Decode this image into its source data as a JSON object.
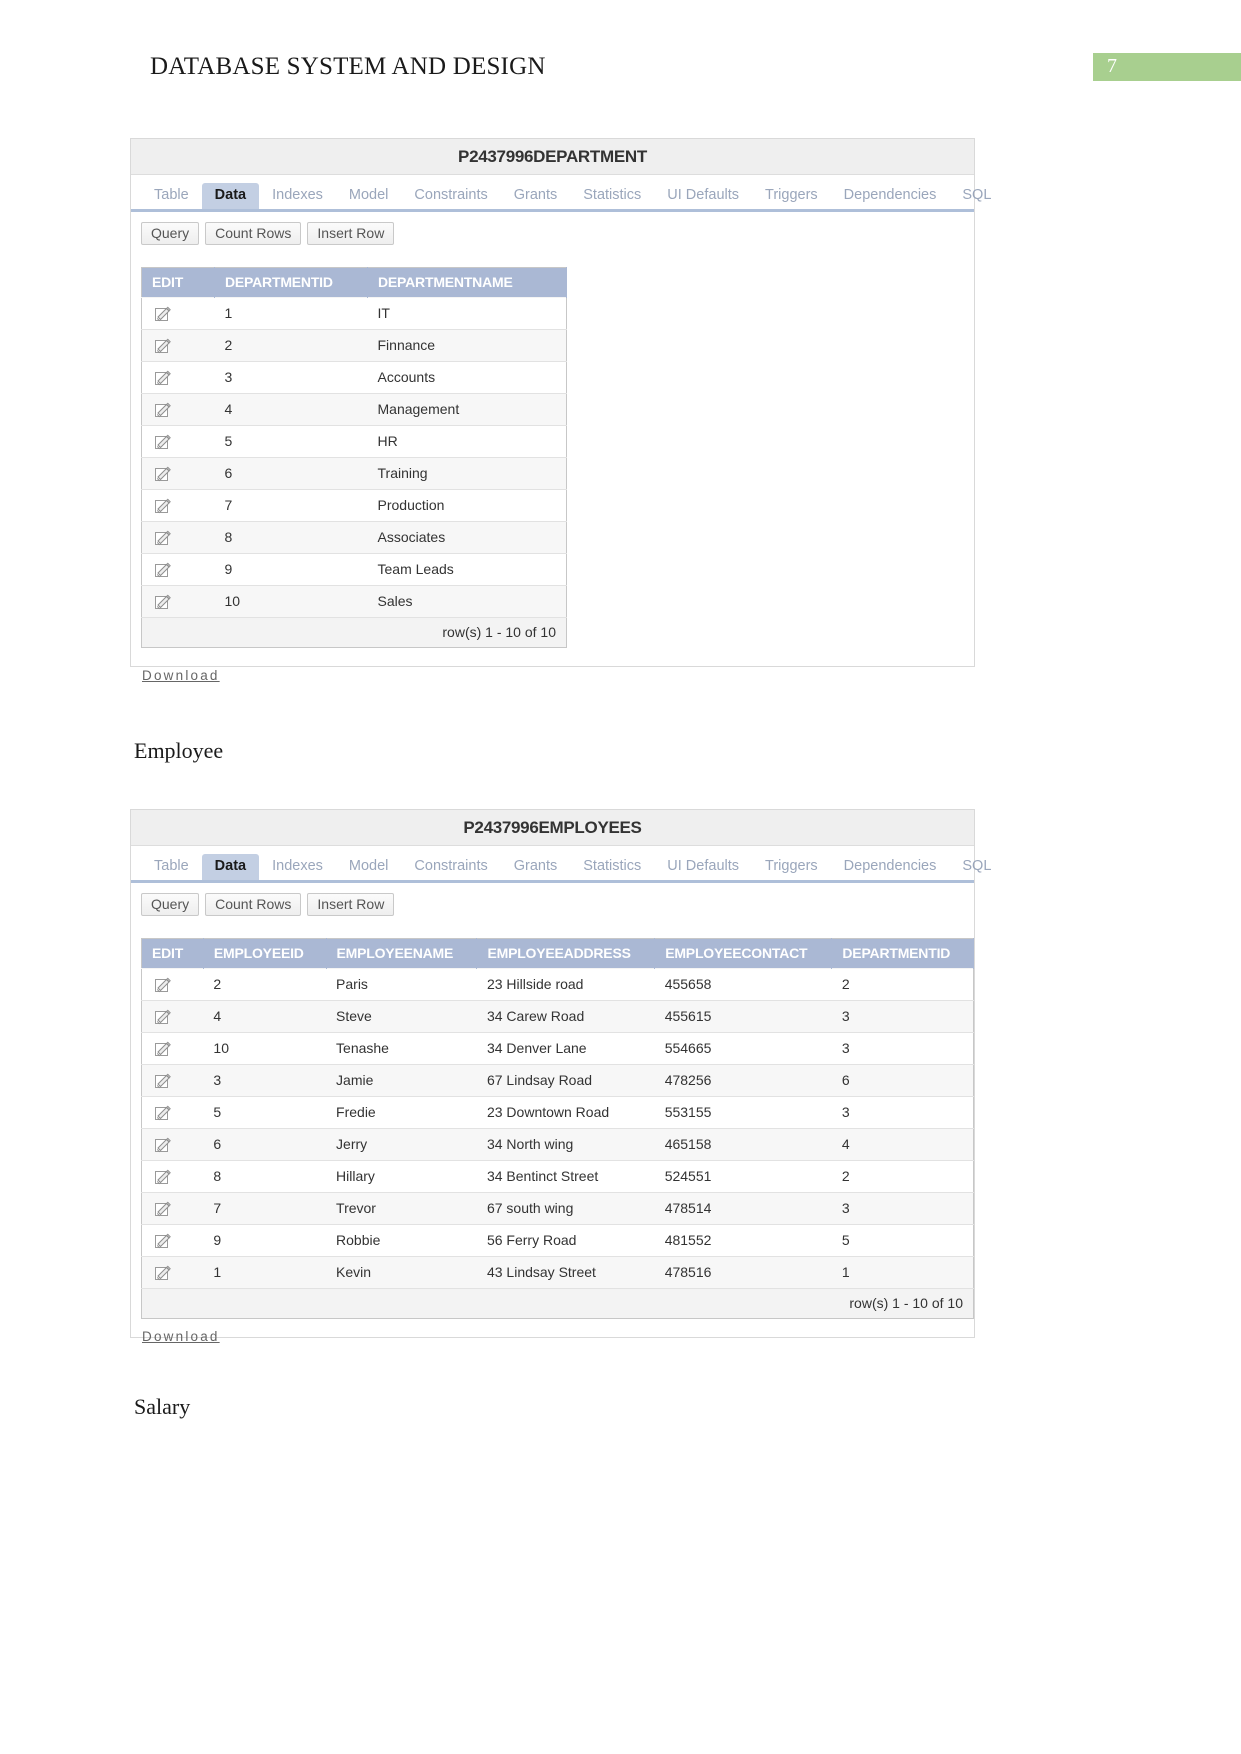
{
  "document": {
    "header_title": "DATABASE SYSTEM AND DESIGN",
    "page_number": "7"
  },
  "colors": {
    "page_badge_green": "#a8cf8f",
    "table_header_blue": "#aab8d4",
    "tab_underline": "#aebfd9",
    "active_tab_bg": "#c3cfe3"
  },
  "sections": {
    "employee_label": "Employee",
    "salary_label": "Salary"
  },
  "department_panel": {
    "title": "P2437996DEPARTMENT",
    "tabs": [
      {
        "label": "Table",
        "active": false
      },
      {
        "label": "Data",
        "active": true
      },
      {
        "label": "Indexes",
        "active": false
      },
      {
        "label": "Model",
        "active": false
      },
      {
        "label": "Constraints",
        "active": false
      },
      {
        "label": "Grants",
        "active": false
      },
      {
        "label": "Statistics",
        "active": false
      },
      {
        "label": "UI Defaults",
        "active": false
      },
      {
        "label": "Triggers",
        "active": false
      },
      {
        "label": "Dependencies",
        "active": false
      },
      {
        "label": "SQL",
        "active": false
      }
    ],
    "buttons": [
      {
        "label": "Query"
      },
      {
        "label": "Count Rows"
      },
      {
        "label": "Insert Row"
      }
    ],
    "columns": [
      "EDIT",
      "DEPARTMENTID",
      "DEPARTMENTNAME"
    ],
    "rows": [
      {
        "edit": "edit-pencil-icon",
        "departmentid": "1",
        "departmentname": "IT"
      },
      {
        "edit": "edit-pencil-icon",
        "departmentid": "2",
        "departmentname": "Finnance"
      },
      {
        "edit": "edit-pencil-icon",
        "departmentid": "3",
        "departmentname": "Accounts"
      },
      {
        "edit": "edit-pencil-icon",
        "departmentid": "4",
        "departmentname": "Management"
      },
      {
        "edit": "edit-pencil-icon",
        "departmentid": "5",
        "departmentname": "HR"
      },
      {
        "edit": "edit-pencil-icon",
        "departmentid": "6",
        "departmentname": "Training"
      },
      {
        "edit": "edit-pencil-icon",
        "departmentid": "7",
        "departmentname": "Production"
      },
      {
        "edit": "edit-pencil-icon",
        "departmentid": "8",
        "departmentname": "Associates"
      },
      {
        "edit": "edit-pencil-icon",
        "departmentid": "9",
        "departmentname": "Team Leads"
      },
      {
        "edit": "edit-pencil-icon",
        "departmentid": "10",
        "departmentname": "Sales"
      }
    ],
    "footer_text": "row(s) 1 - 10 of 10",
    "download_label": "Download"
  },
  "employees_panel": {
    "title": "P2437996EMPLOYEES",
    "tabs": [
      {
        "label": "Table",
        "active": false
      },
      {
        "label": "Data",
        "active": true
      },
      {
        "label": "Indexes",
        "active": false
      },
      {
        "label": "Model",
        "active": false
      },
      {
        "label": "Constraints",
        "active": false
      },
      {
        "label": "Grants",
        "active": false
      },
      {
        "label": "Statistics",
        "active": false
      },
      {
        "label": "UI Defaults",
        "active": false
      },
      {
        "label": "Triggers",
        "active": false
      },
      {
        "label": "Dependencies",
        "active": false
      },
      {
        "label": "SQL",
        "active": false
      }
    ],
    "buttons": [
      {
        "label": "Query"
      },
      {
        "label": "Count Rows"
      },
      {
        "label": "Insert Row"
      }
    ],
    "columns": [
      "EDIT",
      "EMPLOYEEID",
      "EMPLOYEENAME",
      "EMPLOYEEADDRESS",
      "EMPLOYEECONTACT",
      "DEPARTMENTID"
    ],
    "rows": [
      {
        "edit": "edit-pencil-icon",
        "employeeid": "2",
        "employeename": "Paris",
        "employeeaddress": "23 Hillside road",
        "employeecontact": "455658",
        "departmentid": "2"
      },
      {
        "edit": "edit-pencil-icon",
        "employeeid": "4",
        "employeename": "Steve",
        "employeeaddress": "34 Carew Road",
        "employeecontact": "455615",
        "departmentid": "3"
      },
      {
        "edit": "edit-pencil-icon",
        "employeeid": "10",
        "employeename": "Tenashe",
        "employeeaddress": "34 Denver Lane",
        "employeecontact": "554665",
        "departmentid": "3"
      },
      {
        "edit": "edit-pencil-icon",
        "employeeid": "3",
        "employeename": "Jamie",
        "employeeaddress": "67 Lindsay Road",
        "employeecontact": "478256",
        "departmentid": "6"
      },
      {
        "edit": "edit-pencil-icon",
        "employeeid": "5",
        "employeename": "Fredie",
        "employeeaddress": "23 Downtown Road",
        "employeecontact": "553155",
        "departmentid": "3"
      },
      {
        "edit": "edit-pencil-icon",
        "employeeid": "6",
        "employeename": "Jerry",
        "employeeaddress": "34 North wing",
        "employeecontact": "465158",
        "departmentid": "4"
      },
      {
        "edit": "edit-pencil-icon",
        "employeeid": "8",
        "employeename": "Hillary",
        "employeeaddress": "34 Bentinct Street",
        "employeecontact": "524551",
        "departmentid": "2"
      },
      {
        "edit": "edit-pencil-icon",
        "employeeid": "7",
        "employeename": "Trevor",
        "employeeaddress": "67 south wing",
        "employeecontact": "478514",
        "departmentid": "3"
      },
      {
        "edit": "edit-pencil-icon",
        "employeeid": "9",
        "employeename": "Robbie",
        "employeeaddress": "56 Ferry Road",
        "employeecontact": "481552",
        "departmentid": "5"
      },
      {
        "edit": "edit-pencil-icon",
        "employeeid": "1",
        "employeename": "Kevin",
        "employeeaddress": "43 Lindsay Street",
        "employeecontact": "478516",
        "departmentid": "1"
      }
    ],
    "footer_text": "row(s) 1 - 10 of 10",
    "download_label": "Download"
  }
}
